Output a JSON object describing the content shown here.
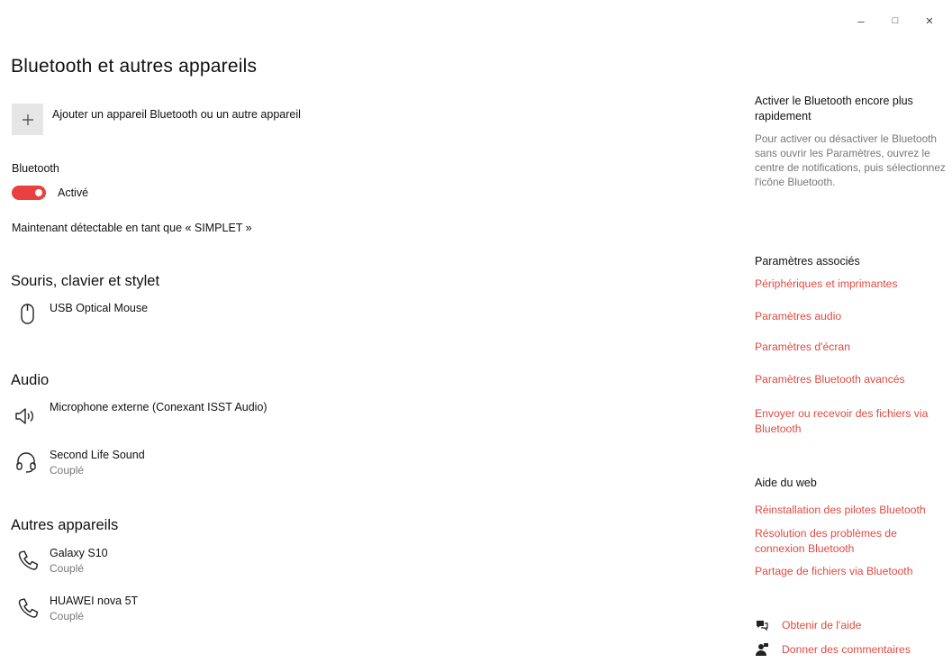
{
  "window": {
    "minimize": "–",
    "maximize": "□",
    "close": "✕"
  },
  "page_title": "Bluetooth et autres appareils",
  "add_device": {
    "icon": "plus-icon",
    "label": "Ajouter un appareil Bluetooth ou un autre appareil"
  },
  "bluetooth": {
    "label": "Bluetooth",
    "toggle_state": "Activé",
    "toggle_on": true,
    "discoverable": "Maintenant détectable en tant que « SIMPLET »"
  },
  "sections": {
    "mouse": {
      "title": "Souris, clavier et stylet",
      "devices": [
        {
          "name": "USB Optical Mouse",
          "icon": "mouse-icon"
        }
      ]
    },
    "audio": {
      "title": "Audio",
      "devices": [
        {
          "name": "Microphone externe (Conexant ISST Audio)",
          "icon": "speaker-icon"
        },
        {
          "name": "Second Life Sound",
          "status": "Couplé",
          "icon": "headset-icon"
        }
      ]
    },
    "other": {
      "title": "Autres appareils",
      "devices": [
        {
          "name": "Galaxy S10",
          "status": "Couplé",
          "icon": "phone-icon"
        },
        {
          "name": "HUAWEI nova 5T",
          "status": "Couplé",
          "icon": "phone-icon"
        }
      ]
    }
  },
  "sidebar": {
    "quick": {
      "heading": "Activer le Bluetooth encore plus rapidement",
      "text": "Pour activer ou désactiver le Bluetooth sans ouvrir les Paramètres, ouvrez le centre de notifications, puis sélectionnez l'icône Bluetooth."
    },
    "related": {
      "heading": "Paramètres associés",
      "links": [
        "Périphériques et imprimantes",
        "Paramètres audio",
        "Paramètres d'écran",
        "Paramètres Bluetooth avancés",
        "Envoyer ou recevoir des fichiers via Bluetooth"
      ]
    },
    "web_help": {
      "heading": "Aide du web",
      "links": [
        "Réinstallation des pilotes Bluetooth",
        "Résolution des problèmes de connexion Bluetooth",
        "Partage de fichiers via Bluetooth"
      ]
    },
    "footer": {
      "get_help": "Obtenir de l'aide",
      "feedback": "Donner des commentaires"
    }
  },
  "colors": {
    "accent": "#e04a41",
    "toggle_on": "#e8413f",
    "button_bg": "#e6e6e6",
    "secondary_text": "#777777"
  }
}
